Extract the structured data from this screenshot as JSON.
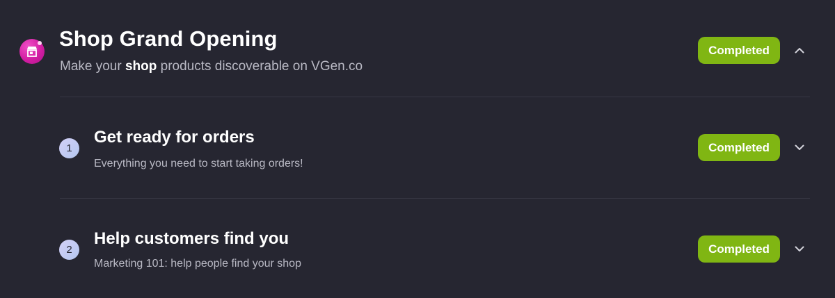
{
  "header": {
    "icon": "shop-storefront-icon",
    "title": "Shop Grand Opening",
    "subtitle_prefix": "Make your ",
    "subtitle_emphasis": "shop",
    "subtitle_suffix": " products discoverable on VGen.co",
    "status": "Completed",
    "toggle_icon": "chevron-up-icon"
  },
  "steps": [
    {
      "number": "1",
      "title": "Get ready for orders",
      "description": "Everything you need to start taking orders!",
      "status": "Completed",
      "toggle_icon": "chevron-down-icon"
    },
    {
      "number": "2",
      "title": "Help customers find you",
      "description": "Marketing 101: help people find your shop",
      "status": "Completed",
      "toggle_icon": "chevron-down-icon"
    }
  ],
  "colors": {
    "background": "#262631",
    "status_completed": "#80b613",
    "icon_accent": "#d21ea3",
    "muted_text": "#b9b9c4",
    "divider": "#373744"
  }
}
